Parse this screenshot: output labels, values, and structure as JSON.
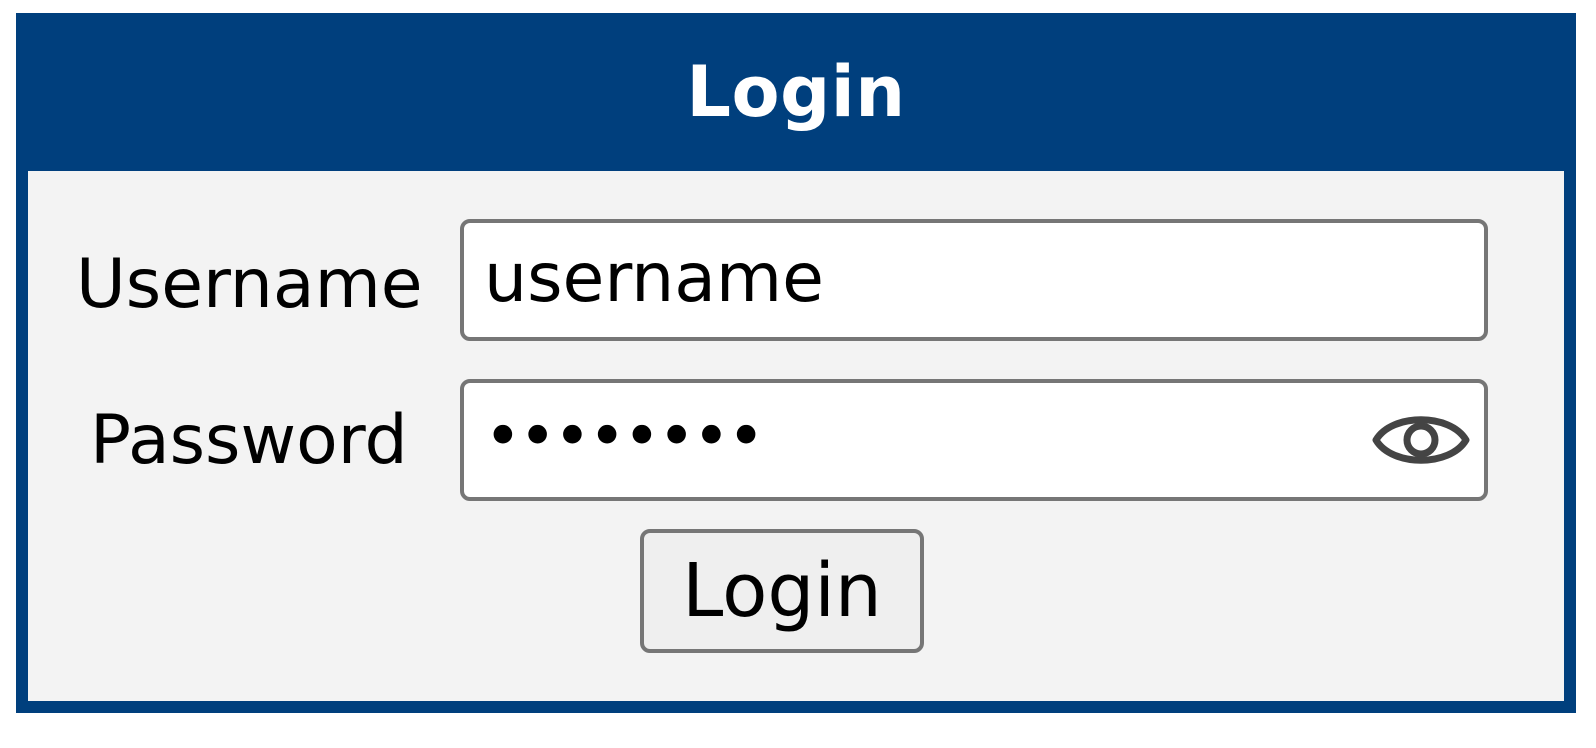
{
  "header": {
    "title": "Login"
  },
  "form": {
    "username": {
      "label": "Username",
      "value": "username"
    },
    "password": {
      "label": "Password",
      "masked_value": "••••••••",
      "toggle_icon": "eye-icon"
    },
    "submit_label": "Login"
  },
  "colors": {
    "header_bg": "#003f7d",
    "body_bg": "#f3f3f3",
    "field_border": "#767676",
    "button_bg": "#efefef"
  }
}
